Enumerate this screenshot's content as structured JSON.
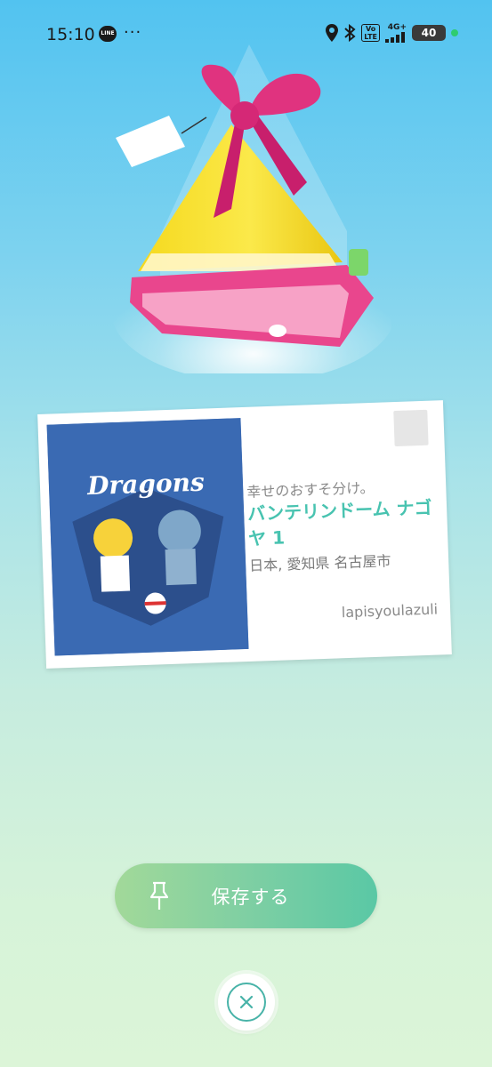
{
  "status_bar": {
    "time": "15:10",
    "line_icon": "LINE",
    "more": "···",
    "volte": "Vo\nLTE",
    "network": "4G+",
    "battery": "40",
    "icons": [
      "location-icon",
      "bluetooth-icon",
      "volte-icon",
      "signal-icon",
      "battery-icon",
      "active-dot-icon"
    ]
  },
  "gift": {
    "icon": "gift-icon",
    "ribbon_color": "#e0337f",
    "body_color": "#f6e23a",
    "base_color": "#e9468d"
  },
  "postcard": {
    "message": "幸せのおすそ分け。",
    "title": "バンテリンドーム ナゴヤ 1",
    "location": "日本, 愛知県 名古屋市",
    "sender": "lapisyoulazuli",
    "photo_logo": "Dragons",
    "photo_bg_color": "#3a6ab3"
  },
  "actions": {
    "save_label": "保存する",
    "save_icon": "pin-icon",
    "close_icon": "close-icon",
    "accent_color": "#48b3a8"
  }
}
